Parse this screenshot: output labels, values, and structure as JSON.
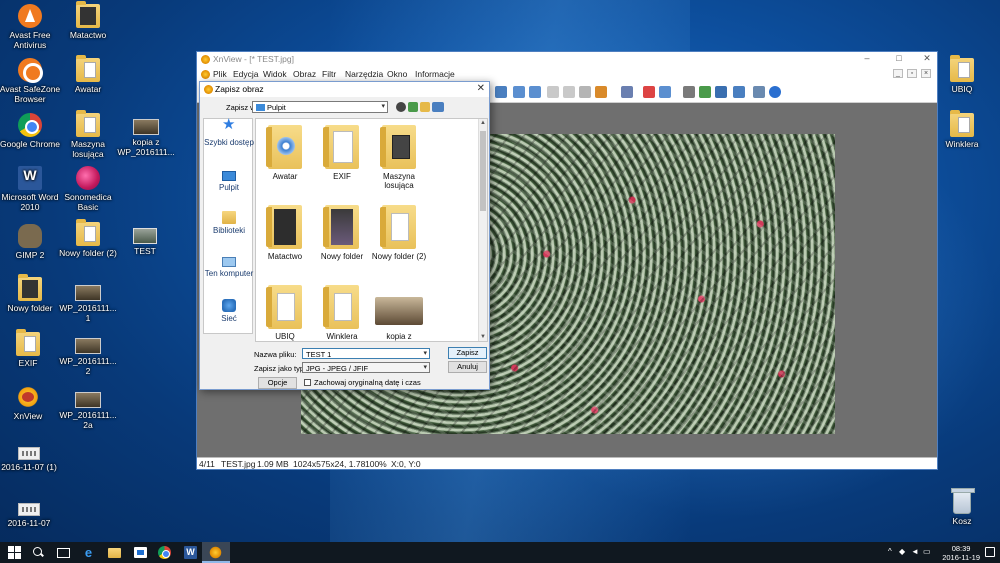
{
  "desktop": {
    "icons_left": [
      {
        "label": "Avast Free Antivirus",
        "icon": "avast-icon"
      },
      {
        "label": "Avast SafeZone Browser",
        "icon": "safezone-icon"
      },
      {
        "label": "Google Chrome",
        "icon": "chrome-icon"
      },
      {
        "label": "Microsoft Word 2010",
        "icon": "word-icon"
      },
      {
        "label": "GIMP 2",
        "icon": "gimp-icon"
      },
      {
        "label": "Nowy folder",
        "icon": "folder-icon"
      },
      {
        "label": "EXIF",
        "icon": "folder-icon"
      },
      {
        "label": "XnView",
        "icon": "xnview-icon"
      },
      {
        "label": "2016-11-07 (1)",
        "icon": "file-icon"
      },
      {
        "label": "2016-11-07",
        "icon": "file-icon"
      }
    ],
    "icons_col2": [
      {
        "label": "Matactwo",
        "icon": "folder-icon"
      },
      {
        "label": "Awatar",
        "icon": "folder-icon"
      },
      {
        "label": "Maszyna losująca",
        "icon": "folder-icon"
      },
      {
        "label": "Sonomedica Basic",
        "icon": "sonomedica-icon"
      },
      {
        "label": "Nowy folder (2)",
        "icon": "folder-icon"
      },
      {
        "label": "WP_2016111... 1",
        "icon": "image-file-icon"
      },
      {
        "label": "WP_2016111... 2",
        "icon": "image-file-icon"
      },
      {
        "label": "WP_2016111... 2a",
        "icon": "image-file-icon"
      }
    ],
    "icons_col3": [
      {
        "label": "kopia z WP_2016111...",
        "icon": "image-file-icon"
      },
      {
        "label": "TEST",
        "icon": "image-file-icon"
      }
    ],
    "icons_right": [
      {
        "label": "UBIQ",
        "icon": "folder-icon"
      },
      {
        "label": "Winklera",
        "icon": "folder-icon"
      },
      {
        "label": "Kosz",
        "icon": "recycle-bin-icon"
      }
    ]
  },
  "xnview": {
    "title": "XnView - [* TEST.jpg]",
    "menu": [
      "Plik",
      "Edycja",
      "Widok",
      "Obraz",
      "Filtr",
      "Narzędzia",
      "Okno",
      "Informacje"
    ],
    "window_controls": {
      "minimize": "–",
      "maximize": "□",
      "close": "✕"
    },
    "mdi_controls": {
      "minimize": "_",
      "restore": "▫",
      "close": "×"
    },
    "status": {
      "position": "4/11",
      "filename": "TEST.jpg",
      "filesize": "1.09 MB",
      "dimensions": "1024x575x24, 1.78",
      "zoom": "100%",
      "coords": "X:0, Y:0"
    }
  },
  "dialog": {
    "title": "Zapisz obraz",
    "close": "✕",
    "save_in_label": "Zapisz w:",
    "save_in_value": "Pulpit",
    "places": [
      {
        "label": "Szybki dostęp",
        "icon": "star-icon"
      },
      {
        "label": "Pulpit",
        "icon": "desktop-icon"
      },
      {
        "label": "Biblioteki",
        "icon": "library-icon"
      },
      {
        "label": "Ten komputer",
        "icon": "computer-icon"
      },
      {
        "label": "Sieć",
        "icon": "network-icon"
      }
    ],
    "files": [
      {
        "label": "Awatar",
        "icon": "folder-icon"
      },
      {
        "label": "EXIF",
        "icon": "folder-icon"
      },
      {
        "label": "Maszyna losująca",
        "icon": "folder-icon"
      },
      {
        "label": "Matactwo",
        "icon": "folder-icon"
      },
      {
        "label": "Nowy folder",
        "icon": "folder-icon"
      },
      {
        "label": "Nowy folder (2)",
        "icon": "folder-icon"
      },
      {
        "label": "UBIQ",
        "icon": "folder-icon"
      },
      {
        "label": "Winklera",
        "icon": "folder-icon"
      },
      {
        "label": "kopia z",
        "icon": "image-thumbnail-icon"
      }
    ],
    "filename_label": "Nazwa pliku:",
    "filename_value": "TEST 1",
    "filetype_label": "Zapisz jako typ:",
    "filetype_value": "JPG - JPEG / JFIF",
    "save_button": "Zapisz",
    "cancel_button": "Anuluj",
    "options_button": "Opcje",
    "keep_date_label": "Zachowaj oryginalną datę i czas"
  },
  "taskbar": {
    "clock_time": "08:39",
    "clock_date": "2016-11-19"
  }
}
